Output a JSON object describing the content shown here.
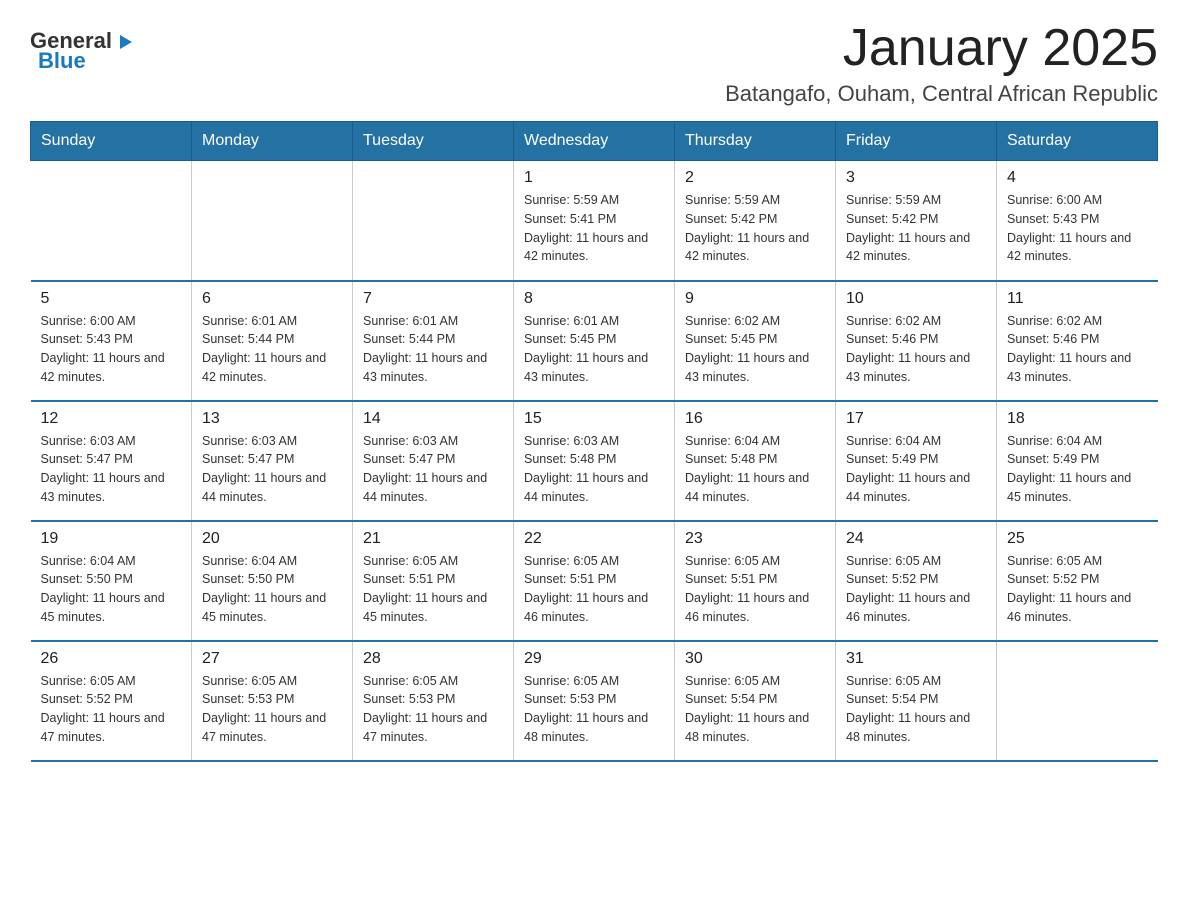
{
  "logo": {
    "text_general": "General",
    "text_blue": "Blue"
  },
  "header": {
    "month_year": "January 2025",
    "location": "Batangafo, Ouham, Central African Republic"
  },
  "days_of_week": [
    "Sunday",
    "Monday",
    "Tuesday",
    "Wednesday",
    "Thursday",
    "Friday",
    "Saturday"
  ],
  "weeks": [
    [
      {
        "day": "",
        "info": ""
      },
      {
        "day": "",
        "info": ""
      },
      {
        "day": "",
        "info": ""
      },
      {
        "day": "1",
        "info": "Sunrise: 5:59 AM\nSunset: 5:41 PM\nDaylight: 11 hours and 42 minutes."
      },
      {
        "day": "2",
        "info": "Sunrise: 5:59 AM\nSunset: 5:42 PM\nDaylight: 11 hours and 42 minutes."
      },
      {
        "day": "3",
        "info": "Sunrise: 5:59 AM\nSunset: 5:42 PM\nDaylight: 11 hours and 42 minutes."
      },
      {
        "day": "4",
        "info": "Sunrise: 6:00 AM\nSunset: 5:43 PM\nDaylight: 11 hours and 42 minutes."
      }
    ],
    [
      {
        "day": "5",
        "info": "Sunrise: 6:00 AM\nSunset: 5:43 PM\nDaylight: 11 hours and 42 minutes."
      },
      {
        "day": "6",
        "info": "Sunrise: 6:01 AM\nSunset: 5:44 PM\nDaylight: 11 hours and 42 minutes."
      },
      {
        "day": "7",
        "info": "Sunrise: 6:01 AM\nSunset: 5:44 PM\nDaylight: 11 hours and 43 minutes."
      },
      {
        "day": "8",
        "info": "Sunrise: 6:01 AM\nSunset: 5:45 PM\nDaylight: 11 hours and 43 minutes."
      },
      {
        "day": "9",
        "info": "Sunrise: 6:02 AM\nSunset: 5:45 PM\nDaylight: 11 hours and 43 minutes."
      },
      {
        "day": "10",
        "info": "Sunrise: 6:02 AM\nSunset: 5:46 PM\nDaylight: 11 hours and 43 minutes."
      },
      {
        "day": "11",
        "info": "Sunrise: 6:02 AM\nSunset: 5:46 PM\nDaylight: 11 hours and 43 minutes."
      }
    ],
    [
      {
        "day": "12",
        "info": "Sunrise: 6:03 AM\nSunset: 5:47 PM\nDaylight: 11 hours and 43 minutes."
      },
      {
        "day": "13",
        "info": "Sunrise: 6:03 AM\nSunset: 5:47 PM\nDaylight: 11 hours and 44 minutes."
      },
      {
        "day": "14",
        "info": "Sunrise: 6:03 AM\nSunset: 5:47 PM\nDaylight: 11 hours and 44 minutes."
      },
      {
        "day": "15",
        "info": "Sunrise: 6:03 AM\nSunset: 5:48 PM\nDaylight: 11 hours and 44 minutes."
      },
      {
        "day": "16",
        "info": "Sunrise: 6:04 AM\nSunset: 5:48 PM\nDaylight: 11 hours and 44 minutes."
      },
      {
        "day": "17",
        "info": "Sunrise: 6:04 AM\nSunset: 5:49 PM\nDaylight: 11 hours and 44 minutes."
      },
      {
        "day": "18",
        "info": "Sunrise: 6:04 AM\nSunset: 5:49 PM\nDaylight: 11 hours and 45 minutes."
      }
    ],
    [
      {
        "day": "19",
        "info": "Sunrise: 6:04 AM\nSunset: 5:50 PM\nDaylight: 11 hours and 45 minutes."
      },
      {
        "day": "20",
        "info": "Sunrise: 6:04 AM\nSunset: 5:50 PM\nDaylight: 11 hours and 45 minutes."
      },
      {
        "day": "21",
        "info": "Sunrise: 6:05 AM\nSunset: 5:51 PM\nDaylight: 11 hours and 45 minutes."
      },
      {
        "day": "22",
        "info": "Sunrise: 6:05 AM\nSunset: 5:51 PM\nDaylight: 11 hours and 46 minutes."
      },
      {
        "day": "23",
        "info": "Sunrise: 6:05 AM\nSunset: 5:51 PM\nDaylight: 11 hours and 46 minutes."
      },
      {
        "day": "24",
        "info": "Sunrise: 6:05 AM\nSunset: 5:52 PM\nDaylight: 11 hours and 46 minutes."
      },
      {
        "day": "25",
        "info": "Sunrise: 6:05 AM\nSunset: 5:52 PM\nDaylight: 11 hours and 46 minutes."
      }
    ],
    [
      {
        "day": "26",
        "info": "Sunrise: 6:05 AM\nSunset: 5:52 PM\nDaylight: 11 hours and 47 minutes."
      },
      {
        "day": "27",
        "info": "Sunrise: 6:05 AM\nSunset: 5:53 PM\nDaylight: 11 hours and 47 minutes."
      },
      {
        "day": "28",
        "info": "Sunrise: 6:05 AM\nSunset: 5:53 PM\nDaylight: 11 hours and 47 minutes."
      },
      {
        "day": "29",
        "info": "Sunrise: 6:05 AM\nSunset: 5:53 PM\nDaylight: 11 hours and 48 minutes."
      },
      {
        "day": "30",
        "info": "Sunrise: 6:05 AM\nSunset: 5:54 PM\nDaylight: 11 hours and 48 minutes."
      },
      {
        "day": "31",
        "info": "Sunrise: 6:05 AM\nSunset: 5:54 PM\nDaylight: 11 hours and 48 minutes."
      },
      {
        "day": "",
        "info": ""
      }
    ]
  ]
}
